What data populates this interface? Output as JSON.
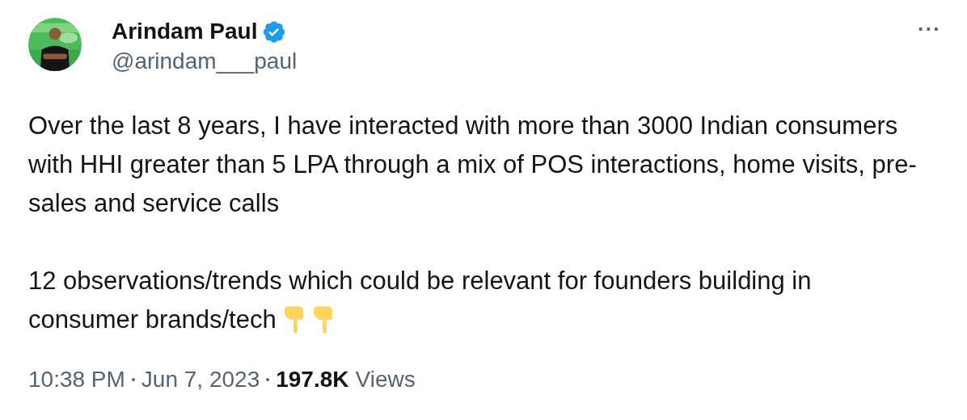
{
  "author": {
    "name": "Arindam Paul",
    "verified": true,
    "handle": "@arindam___paul"
  },
  "more_button": {
    "label": "···"
  },
  "paragraphs": [
    "Over the last 8 years, I have interacted with more than 3000 Indian consumers with HHI greater than 5 LPA through a mix of POS interactions, home visits, pre-sales and service calls",
    "12 observations/trends which could be relevant for founders building in consumer brands/tech"
  ],
  "footer": {
    "time": "10:38 PM",
    "date": "Jun 7, 2023",
    "views_count": "197.8K",
    "views_label": "Views"
  }
}
